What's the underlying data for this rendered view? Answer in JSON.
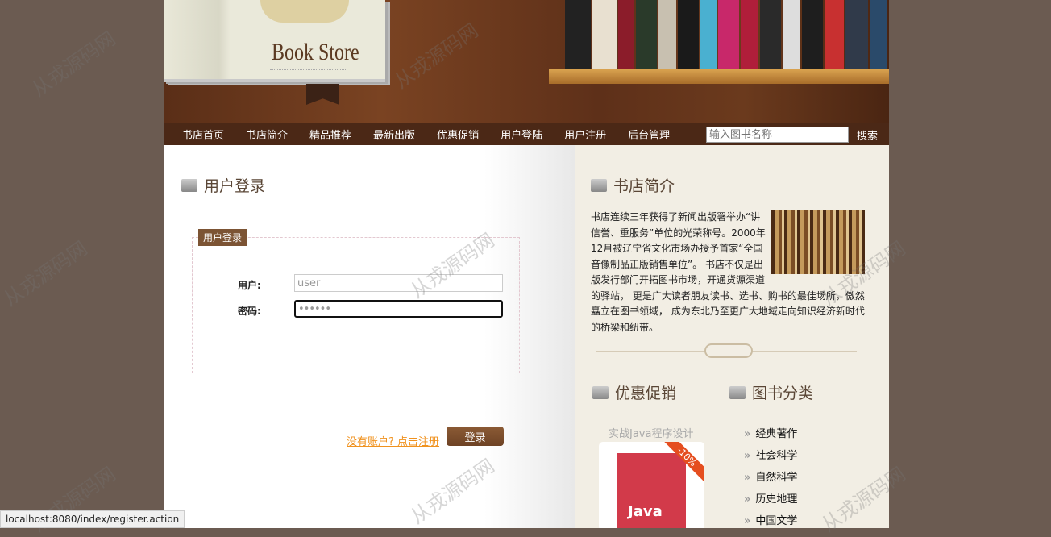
{
  "header": {
    "logo_text": "Book Store"
  },
  "nav": {
    "items": [
      "书店首页",
      "书店简介",
      "精品推荐",
      "最新出版",
      "优惠促销",
      "用户登陆",
      "用户注册",
      "后台管理"
    ],
    "search_placeholder": "输入图书名称",
    "search_label": "搜索"
  },
  "login": {
    "heading": "用户登录",
    "legend": "用户登录",
    "user_label": "用户:",
    "user_value": "user",
    "password_label": "密码:",
    "password_value": "••••••",
    "register_link": "没有账户? 点击注册",
    "submit": "登录"
  },
  "intro": {
    "heading": "书店简介",
    "text": "书店连续三年获得了新闻出版署举办“讲信誉、重服务”单位的光荣称号。2000年12月被辽宁省文化市场办授予首家“全国音像制品正版销售单位”。 书店不仅是出版发行部门开拓图书市场，开通货源渠道的驿站， 更是广大读者朋友读书、选书、购书的最佳场所，傲然矗立在图书领域， 成为东北乃至更广大地域走向知识经济新时代的桥梁和纽带。"
  },
  "promo": {
    "heading": "优惠促销",
    "book_title": "实战Java程序设计",
    "discount": "-10%",
    "cover_text": "Java"
  },
  "categories": {
    "heading": "图书分类",
    "items": [
      "经典著作",
      "社会科学",
      "自然科学",
      "历史地理",
      "中国文学"
    ]
  },
  "watermark": "从戎源码网",
  "status_bar": "localhost:8080/index/register.action"
}
